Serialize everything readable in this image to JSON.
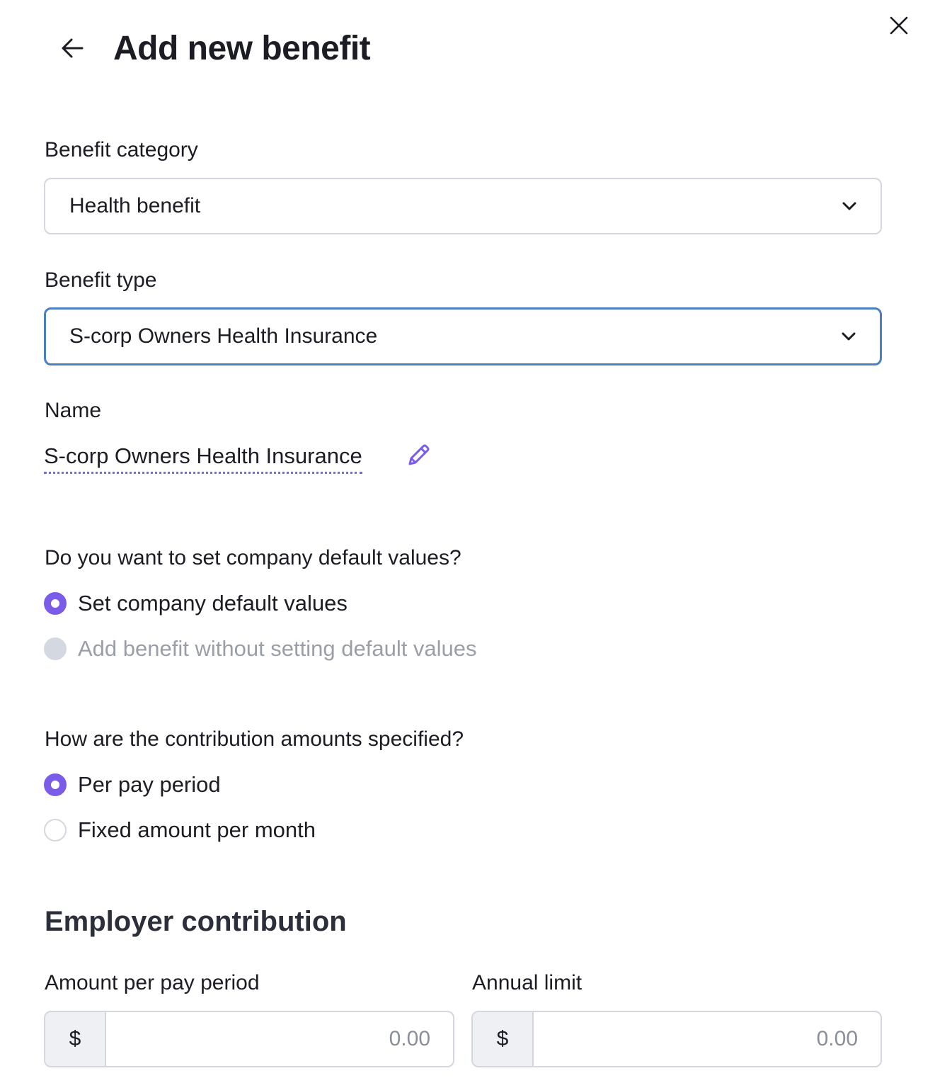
{
  "header": {
    "title": "Add new benefit",
    "back_icon": "arrow-left-icon",
    "close_icon": "close-icon"
  },
  "benefit_category": {
    "label": "Benefit category",
    "selected": "Health benefit"
  },
  "benefit_type": {
    "label": "Benefit type",
    "selected": "S-corp Owners Health Insurance"
  },
  "name": {
    "label": "Name",
    "value": "S-corp Owners Health Insurance",
    "edit_icon": "pencil-icon"
  },
  "defaults_question": {
    "question": "Do you want to set company default values?",
    "options": [
      {
        "label": "Set company default values",
        "checked": true,
        "disabled": false
      },
      {
        "label": "Add benefit without setting default values",
        "checked": false,
        "disabled": true
      }
    ]
  },
  "contribution_question": {
    "question": "How are the contribution amounts specified?",
    "options": [
      {
        "label": "Per pay period",
        "checked": true,
        "disabled": false
      },
      {
        "label": "Fixed amount per month",
        "checked": false,
        "disabled": false
      }
    ]
  },
  "employer_contribution": {
    "title": "Employer contribution",
    "amount": {
      "label": "Amount per pay period",
      "prefix": "$",
      "placeholder": "0.00"
    },
    "annual_limit": {
      "label": "Annual limit",
      "prefix": "$",
      "placeholder": "0.00"
    }
  },
  "colors": {
    "accent": "#7a5ce8",
    "focus_border": "#4a7fc1",
    "border": "#d4d7dd"
  }
}
